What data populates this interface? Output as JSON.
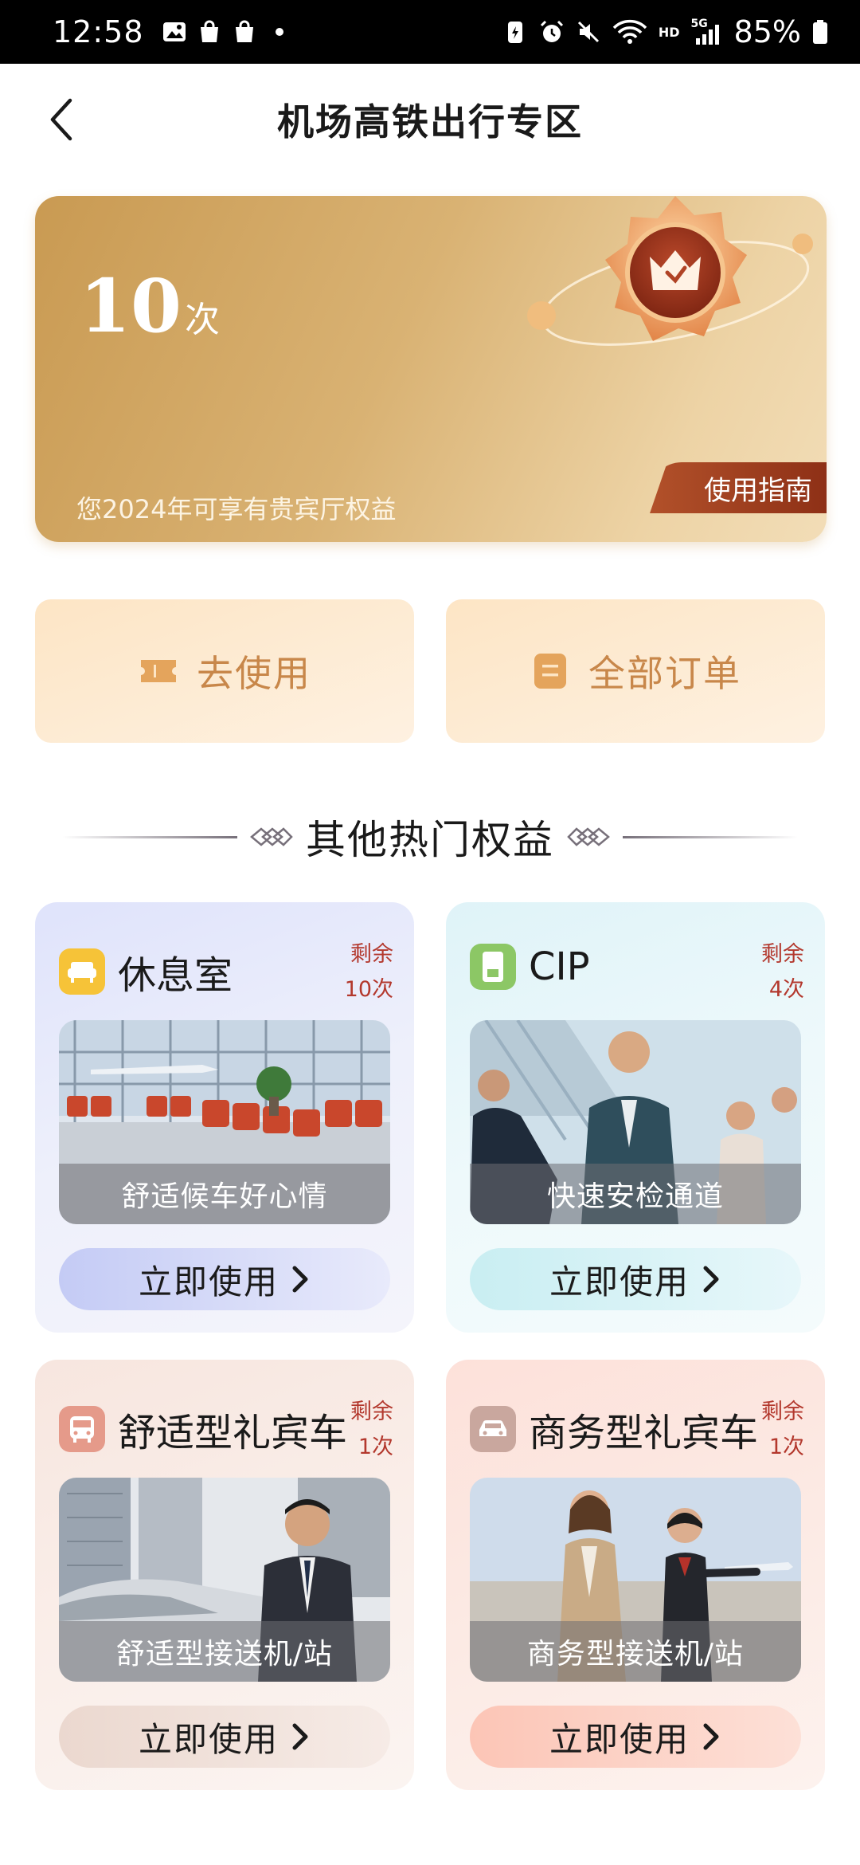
{
  "status_bar": {
    "time": "12:58",
    "battery": "85%",
    "network": "5G",
    "hd": "HD"
  },
  "header": {
    "title": "机场高铁出行专区",
    "back_icon": "chevron-left-icon"
  },
  "hero": {
    "count": "10",
    "unit": "次",
    "description": "您2024年可享有贵宾厅权益",
    "guide_label": "使用指南",
    "colors": {
      "gold_start": "#c99a52",
      "gold_end": "#f2ddb7",
      "guide_bg": "#8e3016"
    }
  },
  "actions": [
    {
      "label": "去使用",
      "icon": "ticket-icon"
    },
    {
      "label": "全部订单",
      "icon": "order-list-icon"
    }
  ],
  "section": {
    "title": "其他热门权益"
  },
  "benefits": [
    {
      "title": "休息室",
      "remain_label": "剩余",
      "remain_count": "10次",
      "caption": "舒适候车好心情",
      "button": "立即使用",
      "icon": "sofa-icon",
      "accent": "#f6c338"
    },
    {
      "title": "CIP",
      "remain_label": "剩余",
      "remain_count": "4次",
      "caption": "快速安检通道",
      "button": "立即使用",
      "icon": "document-icon",
      "accent": "#8cc765"
    },
    {
      "title": "舒适型礼宾车",
      "remain_label": "剩余",
      "remain_count": "1次",
      "caption": "舒适型接送机/站",
      "button": "立即使用",
      "icon": "bus-icon",
      "accent": "#e59a8a"
    },
    {
      "title": "商务型礼宾车",
      "remain_label": "剩余",
      "remain_count": "1次",
      "caption": "商务型接送机/站",
      "button": "立即使用",
      "icon": "car-icon",
      "accent": "#c9a79e"
    }
  ]
}
